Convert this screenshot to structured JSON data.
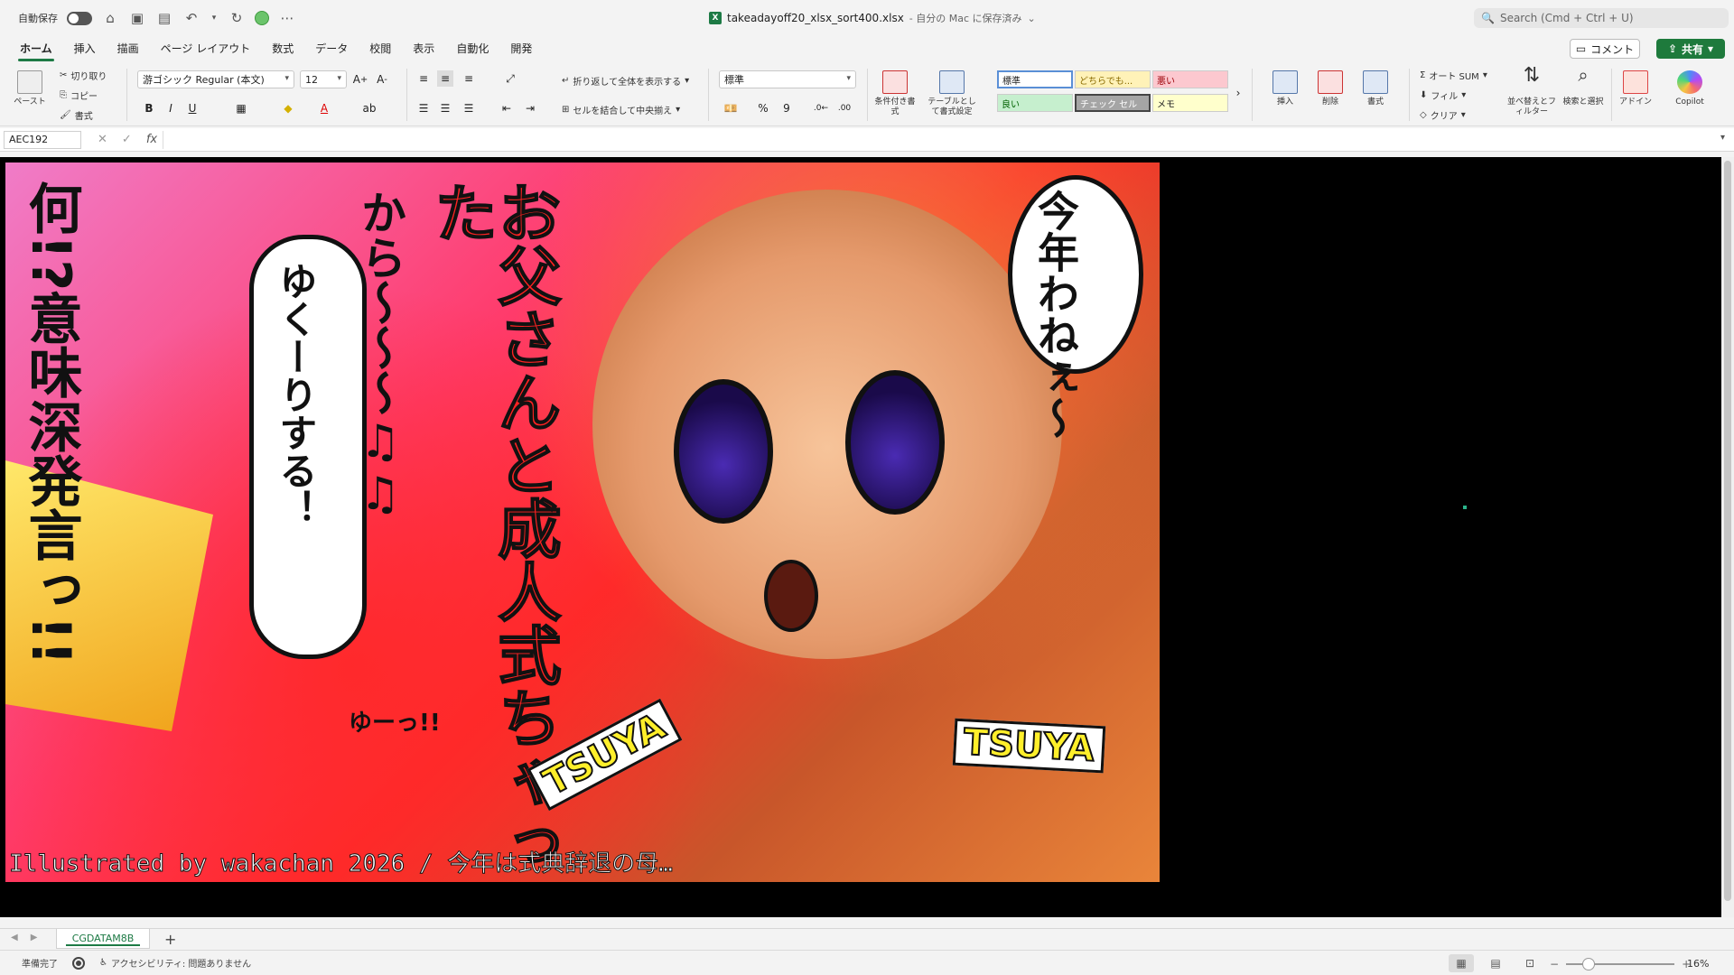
{
  "titlebar": {
    "autosave_label": "自動保存",
    "file_name": "takeadayoff20_xlsx_sort400.xlsx",
    "save_status": "- 自分の Mac に保存済み",
    "search_placeholder": "Search (Cmd + Ctrl + U)"
  },
  "tabs": [
    "ホーム",
    "挿入",
    "描画",
    "ページ レイアウト",
    "数式",
    "データ",
    "校閲",
    "表示",
    "自動化",
    "開発"
  ],
  "buttons": {
    "comment": "コメント",
    "share": "共有"
  },
  "ribbon": {
    "paste": "ペースト",
    "cut": "切り取り",
    "copy": "コピー",
    "format_painter": "書式",
    "font_name": "游ゴシック Regular (本文)",
    "font_size": "12",
    "bold": "B",
    "italic": "I",
    "underline": "U",
    "wrap_text": "折り返して全体を表示する",
    "merge_center": "セルを結合して中央揃え",
    "number_format": "標準",
    "percent": "%",
    "comma": "9",
    "conditional_format": "条件付き書式",
    "table_format": "テーブルとして書式設定",
    "styles": {
      "standard": "標準",
      "neutral": "どちらでも...",
      "bad": "悪い",
      "good": "良い",
      "check_cell": "チェック セル",
      "note": "メモ"
    },
    "insert": "挿入",
    "delete": "削除",
    "format": "書式",
    "autosum": "オート SUM",
    "fill": "フィル",
    "clear": "クリア",
    "sort_filter": "並べ替えとフィルター",
    "find_select": "検索と選択",
    "addins": "アドイン",
    "copilot": "Copilot"
  },
  "formula_bar": {
    "name_box": "AEC192",
    "cancel": "✕",
    "enter": "✓",
    "fx": "fx",
    "value": ""
  },
  "artwork": {
    "bubble_top_right": "今年わねぇ〜",
    "bubble_center": "ゆくーりする！",
    "red_text": "お父さんと成人式ちゃった",
    "from_text": "から〜〜〜♫♫",
    "left_text": "何!?意味深発言っ!!",
    "small_text": "ゆーっ!!",
    "tsuya_a": "TSUYA",
    "tsuya_b": "TSUYA",
    "credit": "Illustrated by wakachan 2026 / 今年は式典辞退の母…"
  },
  "sheet_tab": "CGDATAM8B",
  "status": {
    "ready": "準備完了",
    "accessibility": "アクセシビリティ: 問題ありません",
    "zoom": "16%"
  }
}
